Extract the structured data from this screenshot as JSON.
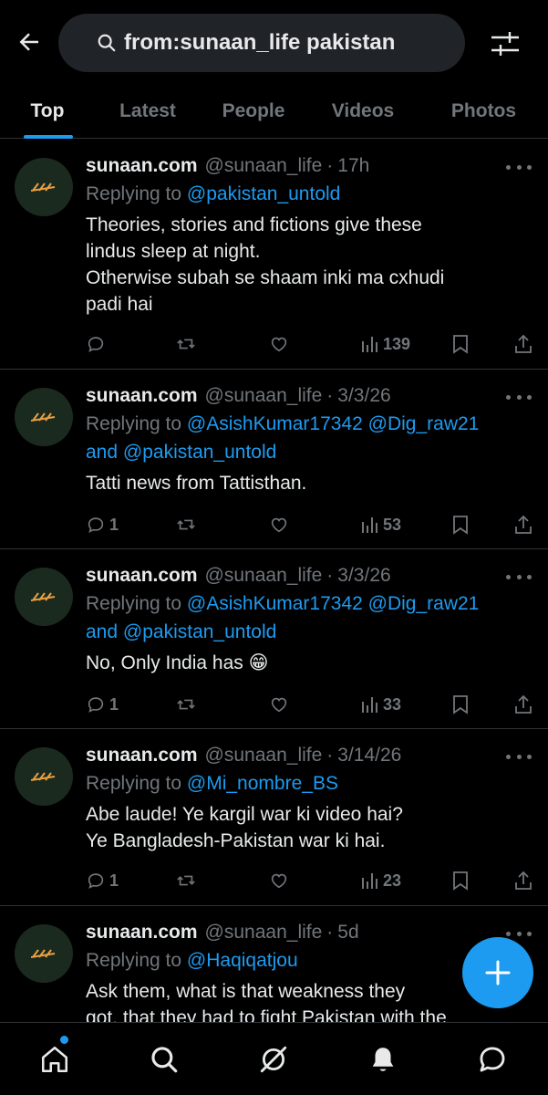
{
  "search": {
    "query": "from:sunaan_life pakistan"
  },
  "tabs": [
    {
      "label": "Top",
      "active": true
    },
    {
      "label": "Latest",
      "active": false
    },
    {
      "label": "People",
      "active": false
    },
    {
      "label": "Videos",
      "active": false
    },
    {
      "label": "Photos",
      "active": false
    }
  ],
  "tweets": [
    {
      "name": "sunaan.com",
      "handle": "@sunaan_life",
      "time": "17h",
      "replying_prefix": "Replying to",
      "mentions_line1": "@pakistan_untold",
      "mentions_line2_prefix": "",
      "mentions_line2": "",
      "text": [
        "Theories, stories and fictions give these",
        "lindus sleep at night.",
        "Otherwise subah se shaam inki ma cxhudi",
        "padi hai"
      ],
      "replies": "",
      "views": "139"
    },
    {
      "name": "sunaan.com",
      "handle": "@sunaan_life",
      "time": "3/3/26",
      "replying_prefix": "Replying to",
      "mentions_line1": "@AsishKumar17342 @Dig_raw21",
      "mentions_line2_prefix": "and",
      "mentions_line2": "@pakistan_untold",
      "text": [
        "Tatti news from Tattisthan."
      ],
      "replies": "1",
      "views": "53"
    },
    {
      "name": "sunaan.com",
      "handle": "@sunaan_life",
      "time": "3/3/26",
      "replying_prefix": "Replying to",
      "mentions_line1": "@AsishKumar17342 @Dig_raw21",
      "mentions_line2_prefix": "and",
      "mentions_line2": "@pakistan_untold",
      "text": [
        "No, Only India has 😁"
      ],
      "replies": "1",
      "views": "33"
    },
    {
      "name": "sunaan.com",
      "handle": "@sunaan_life",
      "time": "3/14/26",
      "replying_prefix": "Replying to",
      "mentions_line1": "@Mi_nombre_BS",
      "mentions_line2_prefix": "",
      "mentions_line2": "",
      "text": [
        "Abe laude! Ye kargil war ki video hai?",
        "Ye Bangladesh-Pakistan war ki hai."
      ],
      "replies": "1",
      "views": "23"
    },
    {
      "name": "sunaan.com",
      "handle": "@sunaan_life",
      "time": "5d",
      "replying_prefix": "Replying to",
      "mentions_line1": "@Haqiqatjou",
      "mentions_line2_prefix": "",
      "mentions_line2": "",
      "text": [
        "Ask them, what is that weakness they",
        "got, that they had to fight Pakistan with the"
      ],
      "replies": "",
      "views": ""
    }
  ],
  "icons": {
    "back": "arrow-left-icon",
    "search": "search-icon",
    "filter": "sliders-icon",
    "reply": "reply-icon",
    "retweet": "retweet-icon",
    "like": "heart-icon",
    "views": "views-icon",
    "bookmark": "bookmark-icon",
    "share": "share-icon",
    "compose": "plus-icon",
    "nav": [
      "home-icon",
      "search-icon",
      "grok-icon",
      "bell-icon",
      "messages-icon"
    ]
  },
  "colors": {
    "accent": "#1d9bf0",
    "background": "#000000",
    "muted": "#71767b",
    "text": "#e7e9ea"
  }
}
